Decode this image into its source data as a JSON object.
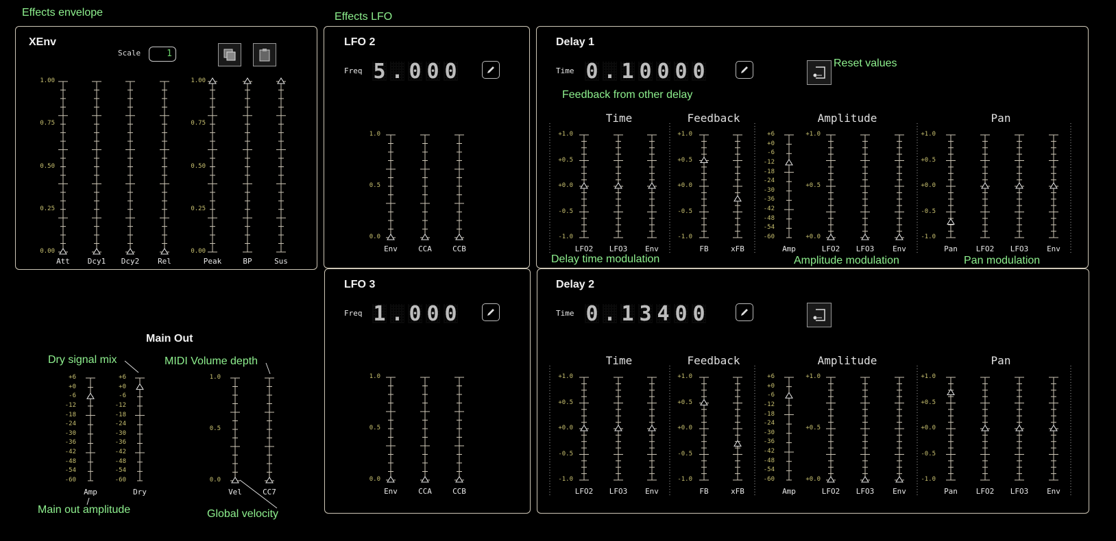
{
  "annotations": {
    "effects_envelope": "Effects envelope",
    "effects_lfo": "Effects LFO",
    "feedback_from_other_delay": "Feedback from other delay",
    "reset_values": "Reset values",
    "delay_time_modulation": "Delay time modulation",
    "amplitude_modulation": "Amplitude modulation",
    "pan_modulation": "Pan modulation",
    "dry_signal_mix": "Dry signal mix",
    "midi_volume_depth": "MIDI Volume depth",
    "main_out_amplitude": "Main out amplitude",
    "global_velocity": "Global velocity"
  },
  "xenv": {
    "title": "XEnv",
    "scale_label": "Scale",
    "scale_value": "1",
    "ticks": [
      "1.00",
      "0.75",
      "0.50",
      "0.25",
      "0.00"
    ],
    "sliders": [
      {
        "label": "Att",
        "value": 0.0
      },
      {
        "label": "Dcy1",
        "value": 0.0
      },
      {
        "label": "Dcy2",
        "value": 0.0
      },
      {
        "label": "Rel",
        "value": 0.0
      },
      {
        "label": "Peak",
        "value": 1.0
      },
      {
        "label": "BP",
        "value": 1.0
      },
      {
        "label": "Sus",
        "value": 1.0
      }
    ]
  },
  "lfo2": {
    "title": "LFO 2",
    "freq_label": "Freq",
    "freq_digits": [
      "5",
      ".",
      "0",
      "0",
      "0"
    ],
    "ticks": [
      "1.0",
      "0.5",
      "0.0"
    ],
    "sliders": [
      {
        "label": "Env",
        "value": 0.0
      },
      {
        "label": "CCA",
        "value": 0.0
      },
      {
        "label": "CCB",
        "value": 0.0
      }
    ]
  },
  "lfo3": {
    "title": "LFO 3",
    "freq_label": "Freq",
    "freq_digits": [
      "1",
      ".",
      "0",
      "0",
      "0"
    ],
    "ticks": [
      "1.0",
      "0.5",
      "0.0"
    ],
    "sliders": [
      {
        "label": "Env",
        "value": 0.0
      },
      {
        "label": "CCA",
        "value": 0.0
      },
      {
        "label": "CCB",
        "value": 0.0
      }
    ]
  },
  "delay_common": {
    "time_label": "Time",
    "group_titles": [
      "Time",
      "Feedback",
      "Amplitude",
      "Pan"
    ],
    "bipolar_ticks": [
      "+1.0",
      "+0.5",
      "+0.0",
      "-0.5",
      "-1.0"
    ],
    "amp_ticks": [
      "+6",
      "+0",
      "-6",
      "-12",
      "-18",
      "-24",
      "-30",
      "-36",
      "-42",
      "-48",
      "-54",
      "-60"
    ],
    "amp_mod_ticks": [
      "+1.0",
      "+0.5",
      "+0.0"
    ]
  },
  "delay1": {
    "title": "Delay 1",
    "time_digits": [
      "0",
      ".",
      "1",
      "0",
      "0",
      "0",
      "0"
    ],
    "time_sliders": [
      {
        "label": "LFO2",
        "value": 0.0
      },
      {
        "label": "LFO3",
        "value": 0.0
      },
      {
        "label": "Env",
        "value": 0.0
      }
    ],
    "feedback_sliders": [
      {
        "label": "FB",
        "value": 0.5
      },
      {
        "label": "xFB",
        "value": -0.25
      }
    ],
    "amp_slider": {
      "label": "Amp",
      "value_db": -12
    },
    "amp_mod_sliders": [
      {
        "label": "LFO2",
        "value": 0.0
      },
      {
        "label": "LFO3",
        "value": 0.0
      },
      {
        "label": "Env",
        "value": 0.0
      }
    ],
    "pan_sliders": [
      {
        "label": "Pan",
        "value": -0.7
      },
      {
        "label": "LFO2",
        "value": 0.0
      },
      {
        "label": "LFO3",
        "value": 0.0
      },
      {
        "label": "Env",
        "value": 0.0
      }
    ]
  },
  "delay2": {
    "title": "Delay 2",
    "time_digits": [
      "0",
      ".",
      "1",
      "3",
      "4",
      "0",
      "0"
    ],
    "time_sliders": [
      {
        "label": "LFO2",
        "value": 0.0
      },
      {
        "label": "LFO3",
        "value": 0.0
      },
      {
        "label": "Env",
        "value": 0.0
      }
    ],
    "feedback_sliders": [
      {
        "label": "FB",
        "value": 0.5
      },
      {
        "label": "xFB",
        "value": -0.3
      }
    ],
    "amp_slider": {
      "label": "Amp",
      "value_db": -6
    },
    "amp_mod_sliders": [
      {
        "label": "LFO2",
        "value": 0.0
      },
      {
        "label": "LFO3",
        "value": 0.0
      },
      {
        "label": "Env",
        "value": 0.0
      }
    ],
    "pan_sliders": [
      {
        "label": "Pan",
        "value": 0.7
      },
      {
        "label": "LFO2",
        "value": 0.0
      },
      {
        "label": "LFO3",
        "value": 0.0
      },
      {
        "label": "Env",
        "value": 0.0
      }
    ]
  },
  "main_out": {
    "title": "Main Out",
    "db_ticks": [
      "+6",
      "+0",
      "-6",
      "-12",
      "-18",
      "-24",
      "-30",
      "-36",
      "-42",
      "-48",
      "-54",
      "-60"
    ],
    "unit_ticks": [
      "1.0",
      "0.5",
      "0.0"
    ],
    "amp": {
      "label": "Amp",
      "value_db": -6
    },
    "dry": {
      "label": "Dry",
      "value_db": 0
    },
    "vel": {
      "label": "Vel",
      "value": 0.0
    },
    "cc7": {
      "label": "CC7",
      "value": 0.0
    }
  },
  "colors": {
    "annotation": "#8ef08e",
    "tick_label": "#c8c070",
    "slider": "#cfc8b8",
    "border": "#cfc8b8"
  }
}
